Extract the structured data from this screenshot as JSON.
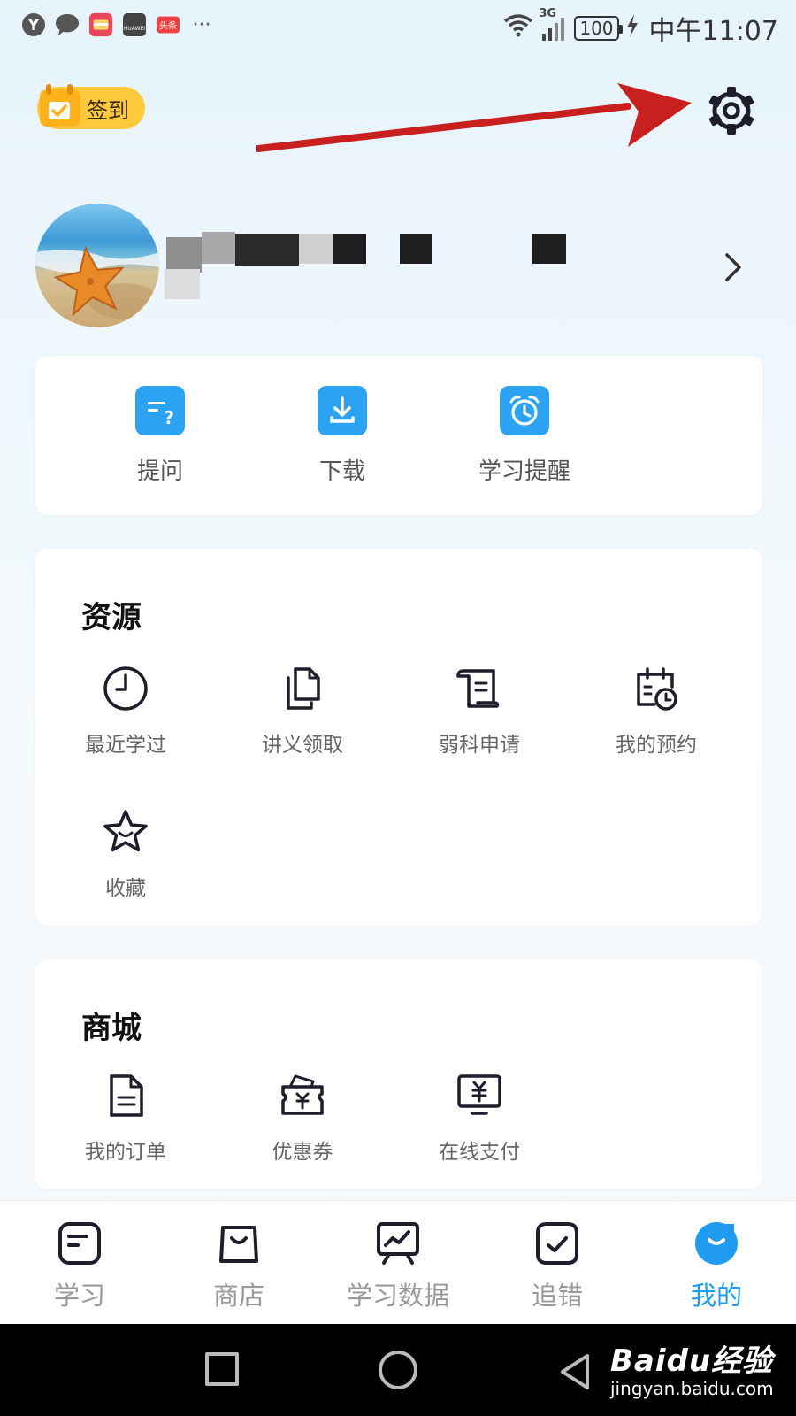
{
  "status_bar": {
    "network": "3G",
    "battery": "100",
    "time": "中午11:07",
    "app_icons": [
      "Y",
      "message-icon",
      "huawei-store-icon",
      "huawei-icon",
      "toutiao-icon"
    ],
    "huawei_label": "HUAWEI",
    "toutiao_label": "头条",
    "more": "···"
  },
  "header": {
    "signin_label": "签到"
  },
  "quick_actions": [
    {
      "label": "提问",
      "icon": "question-doc-icon"
    },
    {
      "label": "下载",
      "icon": "download-icon"
    },
    {
      "label": "学习提醒",
      "icon": "alarm-clock-icon"
    }
  ],
  "resources": {
    "title": "资源",
    "items": [
      {
        "label": "最近学过",
        "icon": "clock-icon"
      },
      {
        "label": "讲义领取",
        "icon": "documents-icon"
      },
      {
        "label": "弱科申请",
        "icon": "scroll-icon"
      },
      {
        "label": "我的预约",
        "icon": "calendar-clock-icon"
      },
      {
        "label": "收藏",
        "icon": "star-icon"
      }
    ]
  },
  "mall": {
    "title": "商城",
    "items": [
      {
        "label": "我的订单",
        "icon": "order-doc-icon"
      },
      {
        "label": "优惠券",
        "icon": "coupon-icon"
      },
      {
        "label": "在线支付",
        "icon": "payment-icon"
      }
    ]
  },
  "tabs": [
    {
      "label": "学习",
      "icon": "study-icon",
      "active": false
    },
    {
      "label": "商店",
      "icon": "shop-bag-icon",
      "active": false
    },
    {
      "label": "学习数据",
      "icon": "chart-board-icon",
      "active": false
    },
    {
      "label": "追错",
      "icon": "check-square-icon",
      "active": false
    },
    {
      "label": "我的",
      "icon": "me-icon",
      "active": true
    }
  ],
  "watermark": {
    "main": "Baidu经验",
    "sub": "jingyan.baidu.com"
  },
  "colors": {
    "accent": "#1f9cf0",
    "quick_icon_bg": "#2ba3f2",
    "signin_bg": "#ffc93d",
    "annotation_arrow": "#c8201e"
  }
}
